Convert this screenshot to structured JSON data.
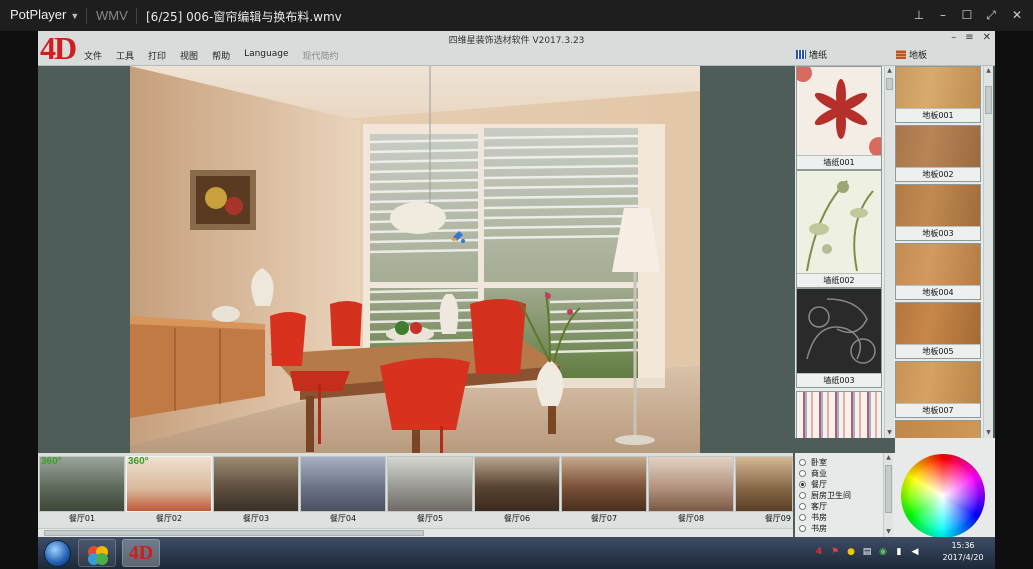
{
  "player": {
    "name": "PotPlayer",
    "format": "WMV",
    "file_title": "[6/25] 006-窗帘编辑与换布料.wmv"
  },
  "app": {
    "title": "四维星装饰选材软件  V2017.3.23",
    "logo": "4D",
    "menu": [
      "文件",
      "工具",
      "打印",
      "视图",
      "帮助",
      "Language",
      "现代简约"
    ],
    "wallpaper_header": "墙纸",
    "floor_header": "地板"
  },
  "wallpapers": [
    {
      "label": "墙纸001",
      "bg": "#f4ede6",
      "accent": "#b5302a"
    },
    {
      "label": "墙纸002",
      "bg": "#eef0e2",
      "accent": "#7f8c4a"
    },
    {
      "label": "墙纸003",
      "bg": "#2b2a2a",
      "accent": "#8a8686"
    },
    {
      "label": "",
      "bg": "#f5f1ec",
      "accent": "#c45a5a"
    }
  ],
  "floors": [
    {
      "label": "地板001",
      "color": "#c99a5e"
    },
    {
      "label": "地板002",
      "color": "#a8764a"
    },
    {
      "label": "地板003",
      "color": "#b07b45"
    },
    {
      "label": "地板004",
      "color": "#c48b52"
    },
    {
      "label": "地板005",
      "color": "#b5763c"
    },
    {
      "label": "地板007",
      "color": "#c89455"
    }
  ],
  "thumbnails": [
    {
      "label": "餐厅01",
      "badge": "360°",
      "tone": "#6f7a6a"
    },
    {
      "label": "餐厅02",
      "badge": "360°",
      "tone": "#c89a7a"
    },
    {
      "label": "餐厅03",
      "badge": "",
      "tone": "#5f5040"
    },
    {
      "label": "餐厅04",
      "badge": "",
      "tone": "#6b7388"
    },
    {
      "label": "餐厅05",
      "badge": "",
      "tone": "#9a9a95"
    },
    {
      "label": "餐厅06",
      "badge": "",
      "tone": "#5a4432"
    },
    {
      "label": "餐厅07",
      "badge": "",
      "tone": "#7a5238"
    },
    {
      "label": "餐厅08",
      "badge": "",
      "tone": "#b39581"
    },
    {
      "label": "餐厅09",
      "badge": "",
      "tone": "#8a6a4a"
    }
  ],
  "rooms": [
    {
      "label": "卧室",
      "selected": false
    },
    {
      "label": "商业",
      "selected": false
    },
    {
      "label": "餐厅",
      "selected": true
    },
    {
      "label": "厨房卫生间",
      "selected": false
    },
    {
      "label": "客厅",
      "selected": false
    },
    {
      "label": "书房",
      "selected": false
    },
    {
      "label": "书房",
      "selected": false
    }
  ],
  "taskbar": {
    "time": "15:36",
    "date": "2017/4/20"
  }
}
